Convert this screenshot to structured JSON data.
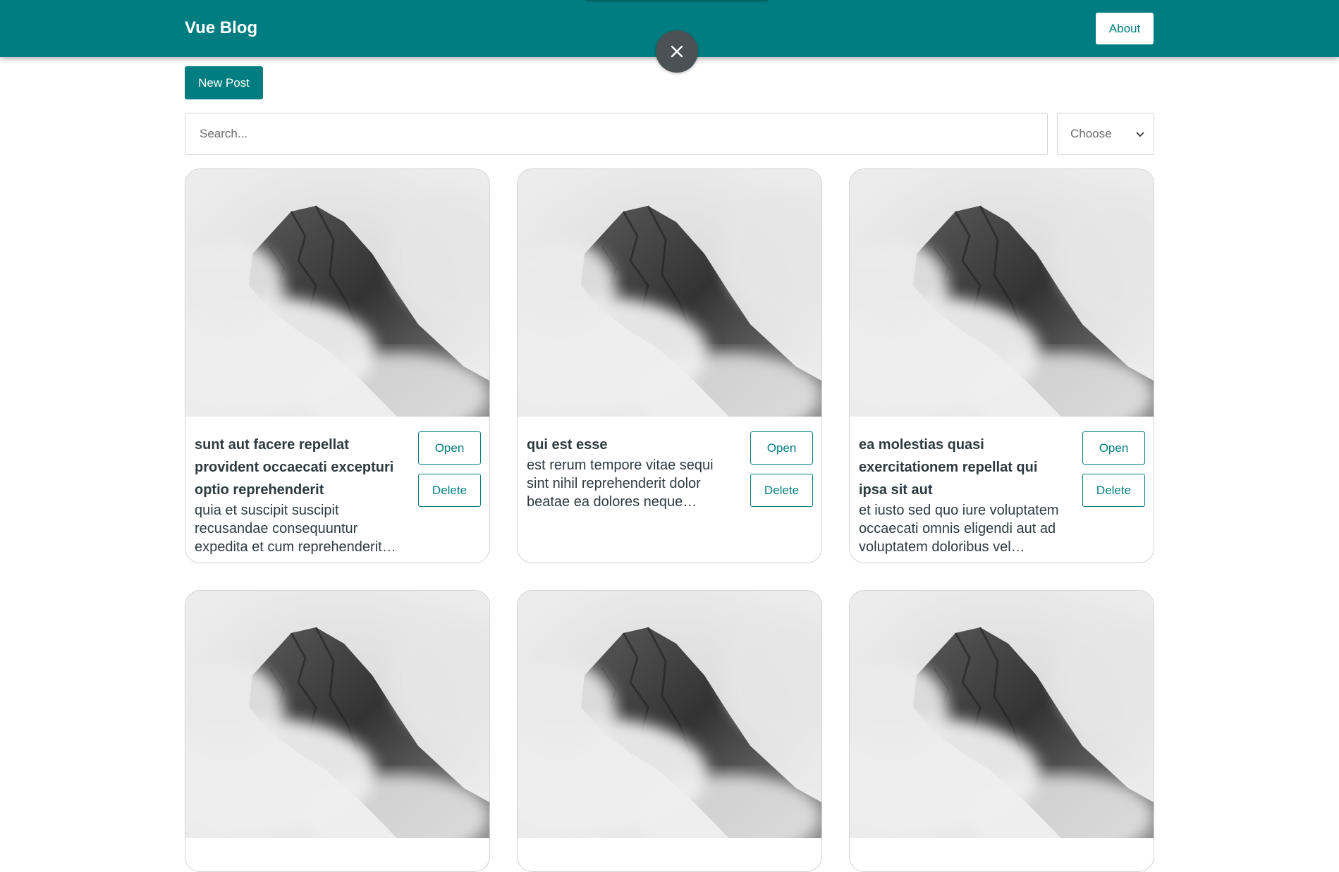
{
  "header": {
    "brand": "Vue Blog",
    "about_label": "About",
    "accent_color": "#007d80"
  },
  "overlay": {
    "close_icon": "close-icon"
  },
  "toolbar": {
    "new_post_label": "New Post",
    "search_placeholder": "Search...",
    "search_value": "",
    "sort_selected": "Choose"
  },
  "posts": [
    {
      "title": "sunt aut facere repellat provident occaecati excepturi optio reprehenderit",
      "excerpt": "quia et suscipit suscipit recusandae consequuntur expedita et cum reprehenderit…",
      "open_label": "Open",
      "delete_label": "Delete"
    },
    {
      "title": "qui est esse",
      "excerpt": "est rerum tempore vitae sequi sint nihil reprehenderit dolor beatae ea dolores neque fugiat…",
      "open_label": "Open",
      "delete_label": "Delete"
    },
    {
      "title": "ea molestias quasi exercitationem repellat qui ipsa sit aut",
      "excerpt": "et iusto sed quo iure voluptatem occaecati omnis eligendi aut ad voluptatem doloribus vel…",
      "open_label": "Open",
      "delete_label": "Delete"
    }
  ]
}
